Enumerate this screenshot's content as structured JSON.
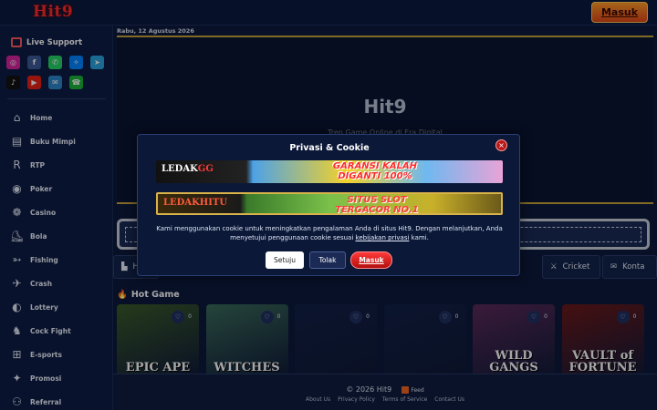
{
  "header": {
    "logo": "Hit9",
    "login_label": "Masuk"
  },
  "sidebar": {
    "support_label": "Live Support",
    "socials": [
      {
        "icon": "instagram-icon",
        "color": "#d6249f"
      },
      {
        "icon": "facebook-icon",
        "color": "#3b5998"
      },
      {
        "icon": "whatsapp-icon",
        "color": "#25d366"
      },
      {
        "icon": "messenger-icon",
        "color": "#0084ff"
      },
      {
        "icon": "telegram-icon",
        "color": "#2aa3e0"
      },
      {
        "icon": "tiktok-icon",
        "color": "#111111"
      },
      {
        "icon": "youtube-icon",
        "color": "#e62117"
      },
      {
        "icon": "email-icon",
        "color": "#2a86c8"
      },
      {
        "icon": "phone-icon",
        "color": "#1bb33a"
      }
    ],
    "items": [
      {
        "label": "Home",
        "icon": "home-icon"
      },
      {
        "label": "Buku Mimpi",
        "icon": "book-icon"
      },
      {
        "label": "RTP",
        "icon": "rtp-icon"
      },
      {
        "label": "Poker",
        "icon": "poker-chip-icon"
      },
      {
        "label": "Casino",
        "icon": "casino-icon"
      },
      {
        "label": "Bola",
        "icon": "shoe-icon"
      },
      {
        "label": "Fishing",
        "icon": "fish-icon"
      },
      {
        "label": "Crash",
        "icon": "crash-icon"
      },
      {
        "label": "Lottery",
        "icon": "lottery-icon"
      },
      {
        "label": "Cock Fight",
        "icon": "rooster-icon"
      },
      {
        "label": "E-sports",
        "icon": "gamepad-icon"
      },
      {
        "label": "Promosi",
        "icon": "promo-icon"
      },
      {
        "label": "Referral",
        "icon": "referral-icon"
      }
    ]
  },
  "main": {
    "date": "Rabu, 12 Agustus 2026",
    "hero_title": "Hit9",
    "hero_subtitle": "Tren Game Online di Era Digital",
    "categories": [
      {
        "label": "H",
        "icon": "home-icon"
      },
      {
        "label": "nis",
        "icon": ""
      },
      {
        "label": "Cricket",
        "icon": "cricket-icon"
      },
      {
        "label": "Konta",
        "icon": "mail-icon"
      }
    ],
    "hot_label": "Hot Game",
    "games": [
      {
        "title": "EPIC APE",
        "count": "0",
        "bg": "#3a5a2a"
      },
      {
        "title": "WITCHES",
        "count": "0",
        "bg": "#3a6a5a"
      },
      {
        "title": "",
        "count": "0",
        "bg": "#122047"
      },
      {
        "title": "",
        "count": "0",
        "bg": "#122047"
      },
      {
        "title": "WILD GANGS",
        "count": "0",
        "bg": "#5a2a5a"
      },
      {
        "title": "VAULT of FORTUNE",
        "count": "0",
        "bg": "#6a1a1a"
      }
    ]
  },
  "footer": {
    "copyright": "© 2026  Hit9",
    "feed_label": "Feed",
    "links": [
      "About Us",
      "Privacy Policy",
      "Terms of Service",
      "Contact Us"
    ]
  },
  "modal": {
    "title": "Privasi & Cookie",
    "banner1_logo_a": "LEDAK",
    "banner1_logo_b": "GG",
    "banner1_text_1": "GARANSI KALAH",
    "banner1_text_2": "DIGANTI 100%",
    "banner2_logo": "LEDAKHITU",
    "banner2_text_1": "SITUS SLOT",
    "banner2_text_2": "TERGACOR NO.1",
    "text_before": "Kami menggunakan cookie untuk meningkatkan pengalaman Anda di situs Hit9. Dengan melanjutkan, Anda menyetujui penggunaan cookie sesuai ",
    "link_text": "kebijakan privasi",
    "text_after": " kami.",
    "accept_label": "Setuju",
    "reject_label": "Tolak",
    "login_label": "Masuk",
    "close_symbol": "×"
  }
}
